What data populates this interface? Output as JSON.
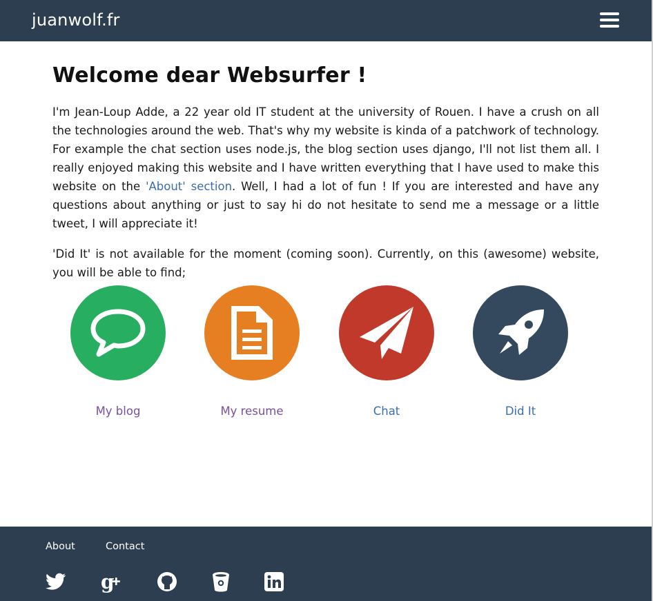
{
  "header": {
    "brand": "juanwolf.fr"
  },
  "main": {
    "title": "Welcome dear Websurfer !",
    "intro_before_link": "I'm Jean-Loup Adde, a 22 year old IT student at the university of Rouen. I have a crush on all the technologies around the web. That's why my website is kinda of a patchwork of technology. For example the chat section uses node.js, the blog section uses django, I'll not list them all. I really enjoyed making this website and I have written everything that I have used to make this website on the ",
    "intro_link": "'About' section",
    "intro_after_link": ". Well, I had a lot of fun ! If you are interested and have any questions about anything or just to say hi do not hesitate to send me a message or a little tweet, I will appreciate it!",
    "second_paragraph": "'Did It' is not available for the moment (coming soon). Currently, on this (awesome) website, you will be able to find;"
  },
  "tiles": [
    {
      "label": "My blog",
      "icon": "speech-bubble-icon",
      "circle_color": "#27ae60",
      "label_color": "#7b4f9d"
    },
    {
      "label": "My resume",
      "icon": "document-icon",
      "circle_color": "#e67e22",
      "label_color": "#7b4f9d"
    },
    {
      "label": "Chat",
      "icon": "paper-plane-icon",
      "circle_color": "#c0392b",
      "label_color": "#3a6ea5"
    },
    {
      "label": "Did It",
      "icon": "rocket-icon",
      "circle_color": "#34495e",
      "label_color": "#3a6ea5"
    }
  ],
  "footer": {
    "links": [
      "About",
      "Contact"
    ],
    "social_icons": [
      "twitter-icon",
      "google-plus-icon",
      "github-icon",
      "bitbucket-icon",
      "linkedin-icon"
    ],
    "background": "#2c3e50"
  }
}
